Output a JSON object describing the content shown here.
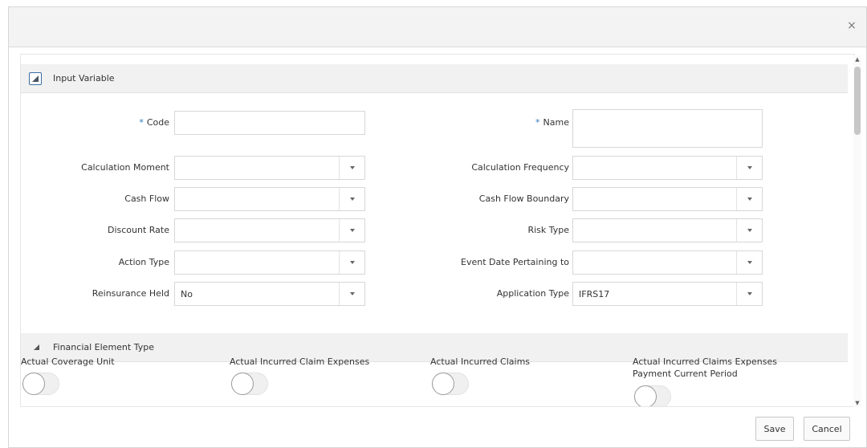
{
  "dialog": {
    "close_glyph": "×",
    "save_label": "Save",
    "cancel_label": "Cancel"
  },
  "input_section": {
    "title": "Input Variable",
    "required_marker": "*",
    "code": {
      "label": "Code",
      "value": ""
    },
    "name": {
      "label": "Name",
      "value": ""
    },
    "calculation_moment": {
      "label": "Calculation Moment",
      "value": ""
    },
    "calculation_frequency": {
      "label": "Calculation Frequency",
      "value": ""
    },
    "cash_flow": {
      "label": "Cash Flow",
      "value": ""
    },
    "cash_flow_boundary": {
      "label": "Cash Flow Boundary",
      "value": ""
    },
    "discount_rate": {
      "label": "Discount Rate",
      "value": ""
    },
    "risk_type": {
      "label": "Risk Type",
      "value": ""
    },
    "action_type": {
      "label": "Action Type",
      "value": ""
    },
    "event_date": {
      "label": "Event Date Pertaining to",
      "value": ""
    },
    "reinsurance_held": {
      "label": "Reinsurance Held",
      "value": "No"
    },
    "application_type": {
      "label": "Application Type",
      "value": "IFRS17"
    }
  },
  "financial_section": {
    "title": "Financial Element Type",
    "toggles": [
      {
        "label": "Actual Coverage Unit",
        "on": false
      },
      {
        "label": "Actual Incurred Claim Expenses",
        "on": false
      },
      {
        "label": "Actual Incurred Claims",
        "on": false
      },
      {
        "label": "Actual Incurred Claims Expenses Payment Current Period",
        "on": false
      }
    ]
  }
}
